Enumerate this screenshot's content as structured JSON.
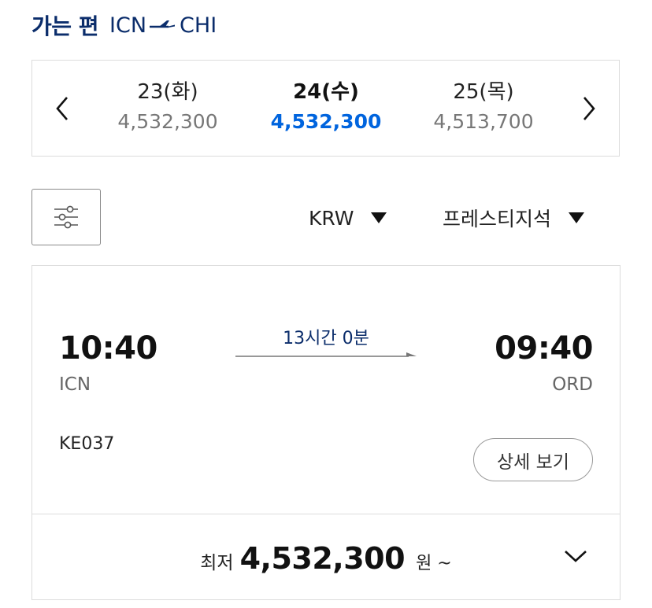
{
  "header": {
    "label": "가는 편",
    "origin": "ICN",
    "destination": "CHI"
  },
  "date_selector": {
    "dates": [
      {
        "label": "23(화)",
        "price": "4,532,300",
        "selected": false
      },
      {
        "label": "24(수)",
        "price": "4,532,300",
        "selected": true
      },
      {
        "label": "25(목)",
        "price": "4,513,700",
        "selected": false
      }
    ]
  },
  "toolbar": {
    "currency": "KRW",
    "cabin_class": "프레스티지석"
  },
  "flight": {
    "departure_time": "10:40",
    "departure_airport": "ICN",
    "duration": "13시간 0분",
    "arrival_time": "09:40",
    "arrival_airport": "ORD",
    "flight_number": "KE037",
    "detail_label": "상세 보기",
    "price_prefix": "최저",
    "price": "4,532,300",
    "price_suffix": "원 ~"
  },
  "colors": {
    "accent_blue": "#0064de",
    "navy": "#0b2d6b",
    "border": "#dcdcdc"
  }
}
